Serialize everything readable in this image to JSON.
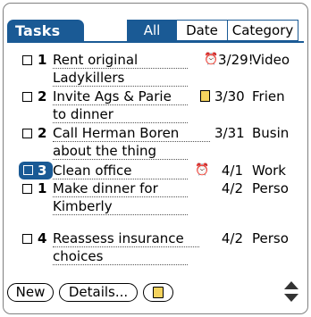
{
  "title": "Tasks",
  "tabs": [
    "All",
    "Date",
    "Category"
  ],
  "tasks": [
    {
      "priority": "1",
      "line1": "Rent original",
      "line2": "Ladykillers",
      "icon": "alarm-icon",
      "date": "3/29!",
      "category": "Video"
    },
    {
      "priority": "2",
      "line1": "Invite Ags & Parie",
      "line2": "to dinner",
      "icon": "note-icon",
      "date": "3/30",
      "category": "Frien"
    },
    {
      "priority": "2",
      "line1": "Call Herman Boren",
      "line2": "about the thing",
      "icon": "",
      "date": "3/31",
      "category": "Busin"
    },
    {
      "priority": "3",
      "line1": "Clean office",
      "line2": "",
      "icon": "alarm-icon",
      "date": "4/1",
      "category": "Work",
      "selected": true
    },
    {
      "priority": "1",
      "line1": "Make dinner for",
      "line2": "Kimberly",
      "icon": "",
      "date": "4/2",
      "category": "Perso"
    },
    {
      "priority": "4",
      "line1": "Reassess insurance",
      "line2": "choices",
      "icon": "",
      "date": "4/2",
      "category": "Perso"
    }
  ],
  "buttons": {
    "new": "New",
    "details": "Details...",
    "note": "note-icon"
  },
  "scroll": {
    "icon": "scroll-arrows-icon"
  },
  "colors": {
    "accent": "#1a5a95",
    "note": "#f4d35e"
  }
}
